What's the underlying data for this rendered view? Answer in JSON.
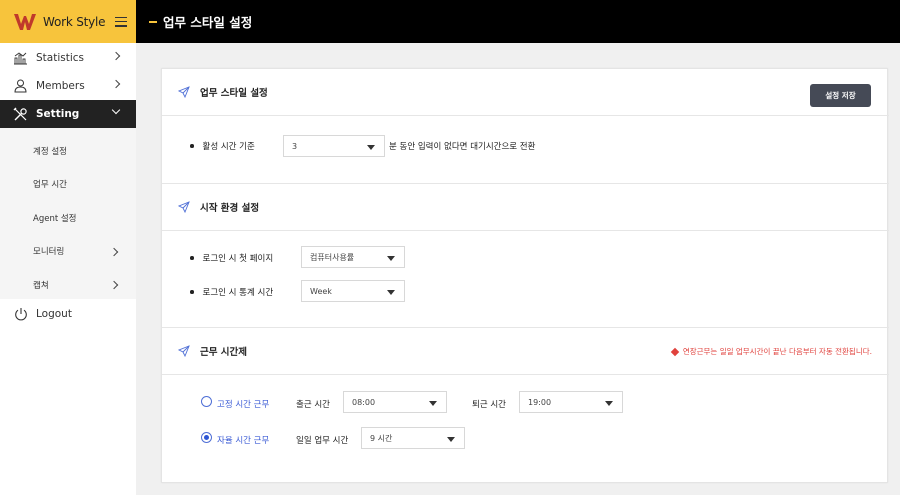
{
  "brand": {
    "name": "Work Style"
  },
  "sidebar": {
    "items": [
      {
        "label": "Statistics",
        "icon": "bar-chart-icon"
      },
      {
        "label": "Members",
        "icon": "user-icon"
      },
      {
        "label": "Setting",
        "icon": "tools-icon"
      }
    ],
    "submenu": [
      {
        "label": "계정 설정"
      },
      {
        "label": "업무 시간"
      },
      {
        "label": "Agent 설정"
      },
      {
        "label": "모니터링"
      },
      {
        "label": "캡쳐"
      }
    ],
    "logout": {
      "label": "Logout",
      "icon": "power-icon"
    }
  },
  "header": {
    "title": "업무 스타일 설정"
  },
  "sections": {
    "work_style": {
      "title": "업무 스타일 설정",
      "save_label": "설정 저장",
      "active_time_label": "활성 시간 기준",
      "active_time_value": "3",
      "active_time_suffix": "분 동안 입력이 없다면 대기시간으로 전환"
    },
    "startup": {
      "title": "시작 환경 설정",
      "first_page_label": "로그인 시 첫 페이지",
      "first_page_value": "컴퓨터사용률",
      "stats_time_label": "로그인 시 통계 시간",
      "stats_time_value": "Week"
    },
    "work_schedule": {
      "title": "근무 시간제",
      "notice": "연장근무는 일일 업무시간이 끝난 다음부터 자동 전환됩니다.",
      "fixed": {
        "label": "고정 시간 근무",
        "checked": false,
        "start_label": "출근 시간",
        "start_value": "08:00",
        "end_label": "퇴근 시간",
        "end_value": "19:00"
      },
      "flexible": {
        "label": "자율 시간 근무",
        "checked": true,
        "daily_label": "일일 업무 시간",
        "daily_value": "9 시간"
      }
    }
  },
  "colors": {
    "brand_yellow": "#f7c43c",
    "header_bg": "#000000",
    "active_nav_bg": "#222222",
    "save_button_bg": "#454a56",
    "notice_red": "#e0413c",
    "radio_blue": "#2d55d4"
  }
}
